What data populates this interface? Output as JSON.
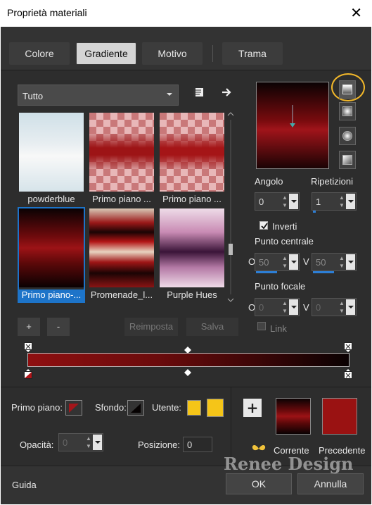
{
  "window": {
    "title": "Proprietà materiali",
    "close_glyph": "✕"
  },
  "tabs": [
    {
      "label": "Colore"
    },
    {
      "label": "Gradiente"
    },
    {
      "label": "Motivo"
    },
    {
      "label": "Trama"
    }
  ],
  "library": {
    "category": "Tutto",
    "browse_icon": "book-icon",
    "export_icon": "arrow-right-icon",
    "items": [
      {
        "label": "powderblue"
      },
      {
        "label": "Primo piano ..."
      },
      {
        "label": "Primo piano ..."
      },
      {
        "label": "Primo piano-..."
      },
      {
        "label": "Promenade_l..."
      },
      {
        "label": "Purple Hues"
      }
    ],
    "add_label": "+",
    "remove_label": "-",
    "reset_label": "Reimposta",
    "save_label": "Salva"
  },
  "gradient": {
    "angle_label": "Angolo",
    "angle_value": "0",
    "repeat_label": "Ripetizioni",
    "repeat_value": "1",
    "invert_label": "Inverti",
    "invert_checked": true,
    "center_label": "Punto centrale",
    "center_h_label": "O",
    "center_h_value": "50",
    "center_v_label": "V",
    "center_v_value": "50",
    "focal_label": "Punto focale",
    "focal_h_label": "O",
    "focal_h_value": "0",
    "focal_v_label": "V",
    "focal_v_value": "0",
    "link_label": "Link",
    "colors": {
      "start": "#8e0f10",
      "end": "#0a0102"
    }
  },
  "materials": {
    "foreground_label": "Primo piano:",
    "background_label": "Sfondo:",
    "user_label": "Utente:",
    "user_color": "#f5c518",
    "opacity_label": "Opacità:",
    "opacity_value": "0",
    "position_label": "Posizione:",
    "position_value": "0",
    "current_label": "Corrente",
    "previous_label": "Precedente",
    "previous_color": "#9a1212"
  },
  "watermark": "Renee Design",
  "footer": {
    "help_label": "Guida",
    "ok_label": "OK",
    "cancel_label": "Annulla"
  }
}
